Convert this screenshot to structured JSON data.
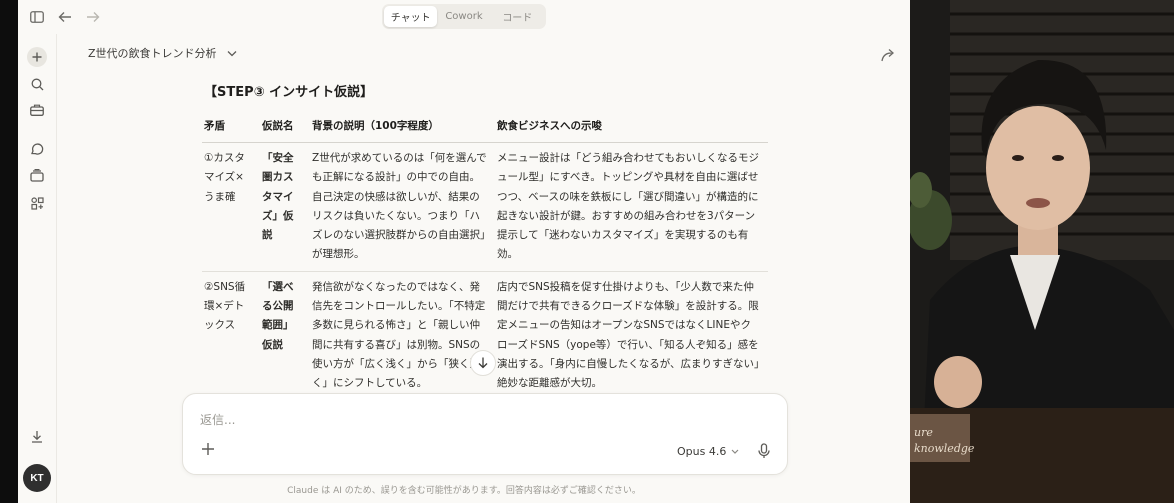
{
  "topbar": {
    "tabs": [
      {
        "label": "チャット",
        "active": true
      },
      {
        "label": "Cowork",
        "active": false
      },
      {
        "label": "コード",
        "active": false
      }
    ]
  },
  "conversation": {
    "title": "Z世代の飲食トレンド分析"
  },
  "content": {
    "heading": "【STEP③ インサイト仮説】",
    "table": {
      "headers": [
        "矛盾",
        "仮説名",
        "背景の説明（100字程度）",
        "飲食ビジネスへの示唆"
      ],
      "rows": [
        {
          "contradiction": "①カスタマイズ×うま確",
          "hypothesis": "「安全圏カスタマイズ」仮説",
          "background": "Z世代が求めているのは「何を選んでも正解になる設計」の中での自由。自己決定の快感は欲しいが、結果のリスクは負いたくない。つまり「ハズレのない選択肢群からの自由選択」が理想形。",
          "implication": "メニュー設計は「どう組み合わせてもおいしくなるモジュール型」にすべき。トッピングや具材を自由に選ばせつつ、ベースの味を鉄板にし「選び間違い」が構造的に起きない設計が鍵。おすすめの組み合わせを3パターン提示して「迷わないカスタマイズ」を実現するのも有効。"
        },
        {
          "contradiction": "②SNS循環×デトックス",
          "hypothesis": "「選べる公開範囲」仮説",
          "background": "発信欲がなくなったのではなく、発信先をコントロールしたい。「不特定多数に見られる怖さ」と「親しい仲間に共有する喜び」は別物。SNSの使い方が「広く浅く」から「狭く深く」にシフトしている。",
          "implication": "店内でSNS投稿を促す仕掛けよりも、「少人数で来た仲間だけで共有できるクローズドな体験」を設計する。限定メニューの告知はオープンなSNSではなくLINEやクローズドSNS（yope等）で行い、「知る人ぞ知る」感を演出する。「身内に自慢したくなるが、広まりすぎない」絶妙な距離感が大切。"
        }
      ]
    }
  },
  "composer": {
    "placeholder": "返信...",
    "model": "Opus 4.6"
  },
  "sidebar": {
    "avatar_initials": "KT"
  },
  "disclaimer": "Claude は AI のため、誤りを含む可能性があります。回答内容は必ずご確認ください。",
  "webcam": {
    "sign_text": "ure knowledge"
  }
}
